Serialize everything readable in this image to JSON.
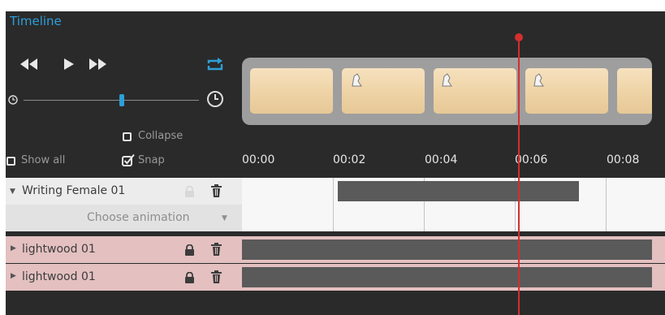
{
  "header": {
    "title": "Timeline"
  },
  "transport": {
    "rewind_icon": "fast-backward-icon",
    "play_icon": "play-icon",
    "forward_icon": "fast-forward-icon",
    "loop_icon": "loop-icon",
    "loop_color": "#2e9fd8"
  },
  "zoom": {
    "min_icon": "clock-small-icon",
    "max_icon": "clock-large-icon",
    "level": 0.56
  },
  "options": {
    "collapse_label": "Collapse",
    "show_all_label": "Show all",
    "snap_label": "Snap",
    "collapse_checked": false,
    "show_all_checked": false,
    "snap_checked": true
  },
  "ruler": {
    "ticks": [
      "00:00",
      "00:02",
      "00:04",
      "00:06",
      "00:08"
    ]
  },
  "playhead": {
    "color": "#d32f2f",
    "time": "00:06"
  },
  "tracks": [
    {
      "name": "Writing Female 01",
      "expanded": true,
      "locked": false,
      "sub_label": "Choose animation"
    },
    {
      "name": "lightwood 01",
      "expanded": false,
      "locked": true
    },
    {
      "name": "lightwood 01",
      "expanded": false,
      "locked": true
    }
  ],
  "colors": {
    "accent": "#2e9fd8",
    "panel": "#2a2a2a",
    "row_light": "#ececec",
    "row_pink": "#e4c0c0",
    "bar": "#5a5a5a"
  }
}
